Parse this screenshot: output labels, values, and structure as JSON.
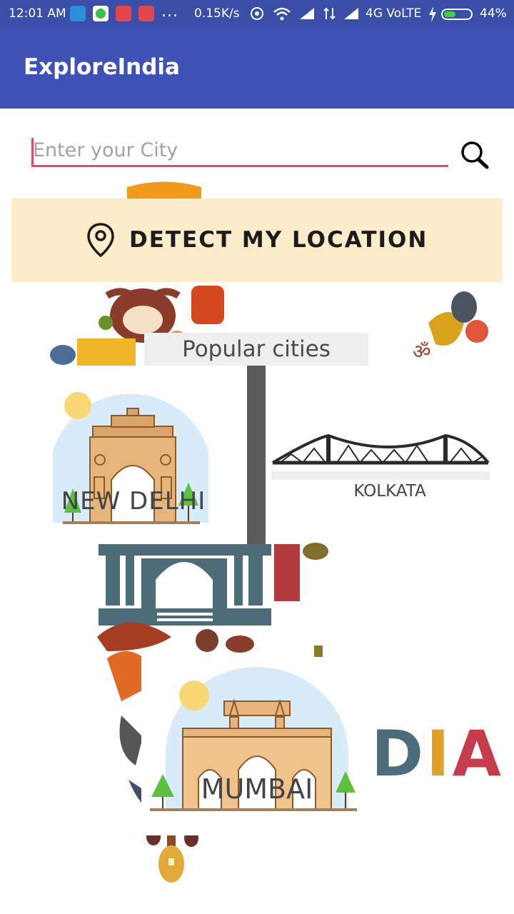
{
  "status_bar": {
    "time": "12:01 AM",
    "notification_icons": [
      "usb-icon",
      "whatsapp-icon",
      "calendar-icon",
      "calendar-icon"
    ],
    "more": "...",
    "network_speed": "0.15K/s",
    "network_label": "4G VoLTE",
    "battery": "44%",
    "battery_level": 0.44
  },
  "app_bar": {
    "title": "ExploreIndia"
  },
  "search": {
    "placeholder": "Enter your City",
    "value": ""
  },
  "detect_location": {
    "label": "DETECT MY LOCATION",
    "icon": "location-pin-icon"
  },
  "popular": {
    "heading": "Popular cities",
    "cities": [
      {
        "name": "NEW DELHI",
        "image": "india-gate-illustration"
      },
      {
        "name": "KOLKATA",
        "image": "howrah-bridge-illustration"
      },
      {
        "name": "MUMBAI",
        "image": "gateway-of-india-illustration"
      }
    ]
  },
  "background": {
    "watermark_text": "DIA"
  },
  "colors": {
    "status_bar": "#3a4ea8",
    "app_bar": "#3f51b5",
    "accent": "#e8437a",
    "detect_bg": "#fdecc9"
  }
}
